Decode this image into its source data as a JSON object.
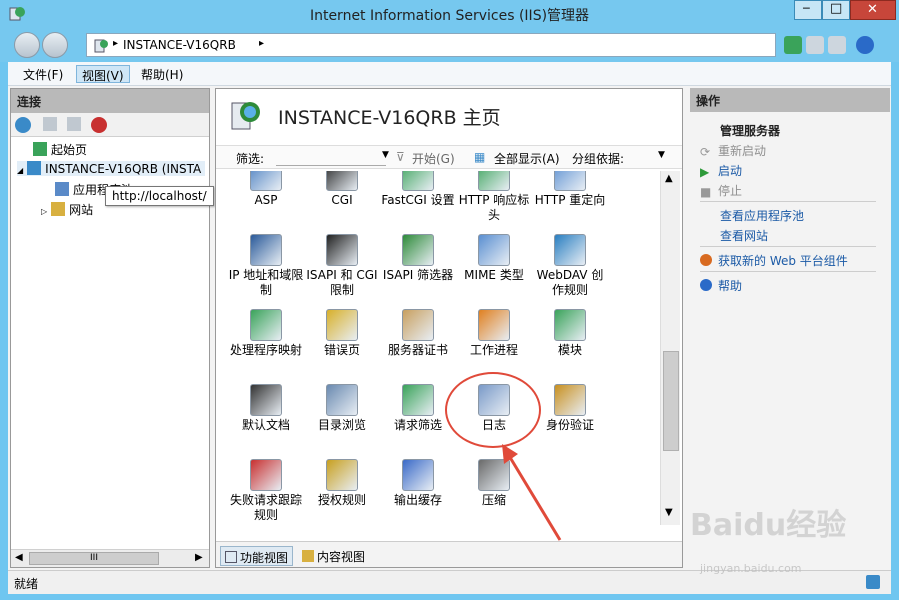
{
  "window": {
    "title": "Internet Information Services (IIS)管理器",
    "controls": {
      "minimize": "─",
      "maximize": "□",
      "close": "✕"
    }
  },
  "address": {
    "breadcrumb": "INSTANCE-V16QRB",
    "sep": "▸"
  },
  "menu": {
    "items": [
      {
        "label": "文件(F)"
      },
      {
        "label": "视图(V)"
      },
      {
        "label": "帮助(H)"
      }
    ]
  },
  "left_panel": {
    "title": "连接",
    "tree": [
      {
        "label": "起始页"
      },
      {
        "label": "INSTANCE-V16QRB (INSTA"
      },
      {
        "label": "应用程序池"
      },
      {
        "label": "网站"
      }
    ],
    "tooltip": "http://localhost/",
    "scroll_mark": "III"
  },
  "center": {
    "title": "INSTANCE-V16QRB 主页",
    "filter": {
      "label": "筛选:",
      "start": "开始(G)",
      "show_all": "全部显示(A)",
      "group_by": "分组依据:"
    },
    "features": [
      {
        "label": "ASP",
        "icon": "asp-icon",
        "color": "#4a7fc1"
      },
      {
        "label": "CGI",
        "icon": "cgi-icon",
        "color": "#222222"
      },
      {
        "label": "FastCGI 设置",
        "icon": "fastcgi-icon",
        "color": "#3aa35a"
      },
      {
        "label": "HTTP 响应标头",
        "icon": "http-headers-icon",
        "color": "#3aa35a"
      },
      {
        "label": "HTTP 重定向",
        "icon": "http-redirect-icon",
        "color": "#5a8fd1"
      },
      {
        "label": "IP 地址和域限制",
        "icon": "ip-restrictions-icon",
        "color": "#2a5a9a"
      },
      {
        "label": "ISAPI 和 CGI 限制",
        "icon": "isapi-cgi-icon",
        "color": "#222222"
      },
      {
        "label": "ISAPI 筛选器",
        "icon": "isapi-filter-icon",
        "color": "#2e8b3a"
      },
      {
        "label": "MIME 类型",
        "icon": "mime-icon",
        "color": "#5a8fd1"
      },
      {
        "label": "WebDAV 创作规则",
        "icon": "webdav-icon",
        "color": "#2a7fc1"
      },
      {
        "label": "处理程序映射",
        "icon": "handler-mappings-icon",
        "color": "#3aa35a"
      },
      {
        "label": "错误页",
        "icon": "error-pages-icon",
        "color": "#d8b02a"
      },
      {
        "label": "服务器证书",
        "icon": "certificates-icon",
        "color": "#c8a060"
      },
      {
        "label": "工作进程",
        "icon": "worker-process-icon",
        "color": "#e08020"
      },
      {
        "label": "模块",
        "icon": "modules-icon",
        "color": "#3aa35a"
      },
      {
        "label": "默认文档",
        "icon": "default-document-icon",
        "color": "#333333"
      },
      {
        "label": "目录浏览",
        "icon": "directory-browsing-icon",
        "color": "#6a8ab0"
      },
      {
        "label": "请求筛选",
        "icon": "request-filtering-icon",
        "color": "#3aa35a"
      },
      {
        "label": "日志",
        "icon": "logging-icon",
        "color": "#7a9ac8"
      },
      {
        "label": "身份验证",
        "icon": "authentication-icon",
        "color": "#c89020"
      },
      {
        "label": "失败请求跟踪规则",
        "icon": "failed-request-icon",
        "color": "#c83030"
      },
      {
        "label": "授权规则",
        "icon": "authorization-icon",
        "color": "#c8a020"
      },
      {
        "label": "输出缓存",
        "icon": "output-cache-icon",
        "color": "#3a6ac8"
      },
      {
        "label": "压缩",
        "icon": "compression-icon",
        "color": "#6a6a6a"
      }
    ],
    "views": [
      {
        "label": "功能视图"
      },
      {
        "label": "内容视图"
      }
    ]
  },
  "right_panel": {
    "title": "操作",
    "actions": [
      {
        "label": "管理服务器",
        "style": "bold",
        "icon": ""
      },
      {
        "label": "重新启动",
        "style": "disabled",
        "icon": "restart-icon"
      },
      {
        "label": "启动",
        "style": "link",
        "icon": "start-icon"
      },
      {
        "label": "停止",
        "style": "disabled",
        "icon": "stop-icon"
      },
      {
        "label": "查看应用程序池",
        "style": "link",
        "icon": ""
      },
      {
        "label": "查看网站",
        "style": "link",
        "icon": ""
      },
      {
        "label": "获取新的 Web 平台组件",
        "style": "link",
        "icon": "web-platform-icon"
      },
      {
        "label": "帮助",
        "style": "link",
        "icon": "help-icon"
      }
    ]
  },
  "status": {
    "text": "就绪"
  },
  "watermark": {
    "main": "Baidu经验",
    "sub": "jingyan.baidu.com"
  },
  "colors": {
    "titlebar": "#76c8ef",
    "close_button": "#c7463a",
    "annotation": "#e04a3a",
    "link": "#1b5aa6"
  }
}
